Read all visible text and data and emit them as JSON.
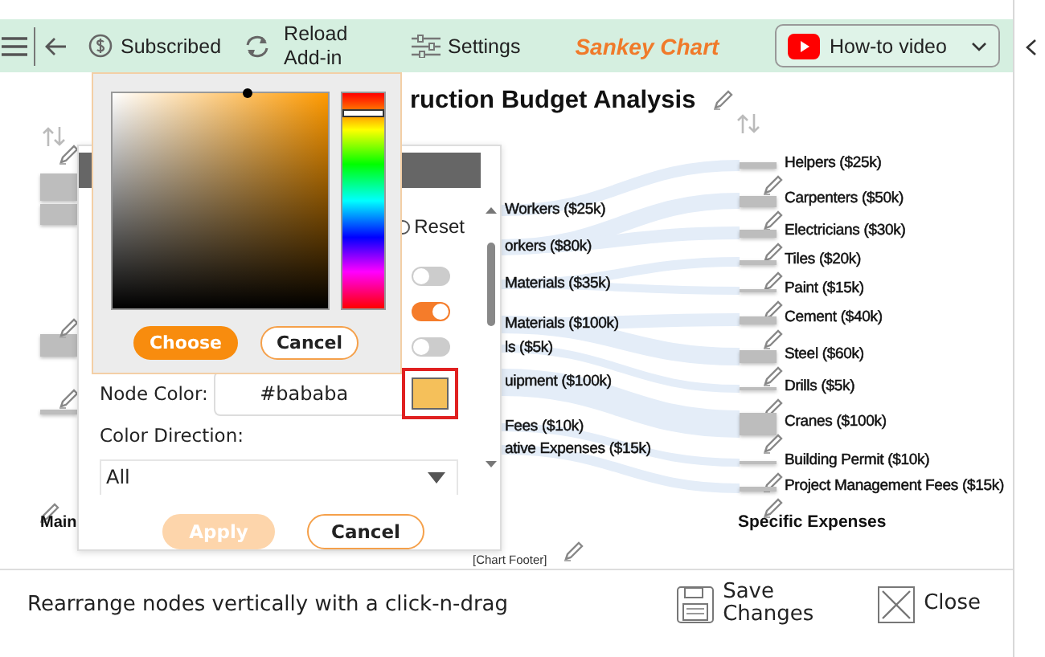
{
  "toolbar": {
    "subscribed": "Subscribed",
    "reload": "Reload Add-in",
    "settings": "Settings",
    "app_title": "Sankey Chart",
    "video_button": "How-to video"
  },
  "chart": {
    "title": "ruction Budget Analysis",
    "left_nodes": [
      "Workers ($25k)",
      "orkers ($80k)",
      "Materials ($35k)",
      "Materials ($100k)",
      "ls ($5k)",
      "uipment ($100k)",
      "Fees ($10k)",
      "ative Expenses ($15k)"
    ],
    "right_nodes": [
      "Helpers ($25k)",
      "Carpenters ($50k)",
      "Electricians ($30k)",
      "Tiles ($20k)",
      "Paint ($15k)",
      "Cement ($40k)",
      "Steel ($60k)",
      "Drills ($5k)",
      "Cranes ($100k)",
      "Building Permit ($10k)",
      "Project Management Fees ($15k)"
    ],
    "left_column_label": "Main",
    "right_column_label": "Specific Expenses",
    "footer": "[Chart Footer]"
  },
  "settings_panel": {
    "reset_label": "Reset",
    "reset_checked": false,
    "toggles": [
      {
        "on": false
      },
      {
        "on": true
      },
      {
        "on": false
      }
    ],
    "node_color": {
      "label": "Node Color:",
      "value": "#bababa",
      "color": "#f5c05a"
    },
    "color_direction": {
      "label": "Color Direction:",
      "value": "All"
    },
    "buttons": [
      {
        "label": "Apply",
        "disabled": true
      },
      {
        "label": "Cancel",
        "disabled": false
      }
    ]
  },
  "color_picker": {
    "hue": {
      "level": 0.92
    },
    "buttons": [
      {
        "label": "Choose",
        "kind": "primary"
      },
      {
        "label": "Cancel",
        "kind": "secondary"
      }
    ]
  },
  "status_bar": {
    "hint": "Rearrange nodes vertically with a click-n-drag",
    "buttons": [
      {
        "label": "Save Changes",
        "kind": "save"
      },
      {
        "label": "Close",
        "kind": "close"
      }
    ]
  }
}
